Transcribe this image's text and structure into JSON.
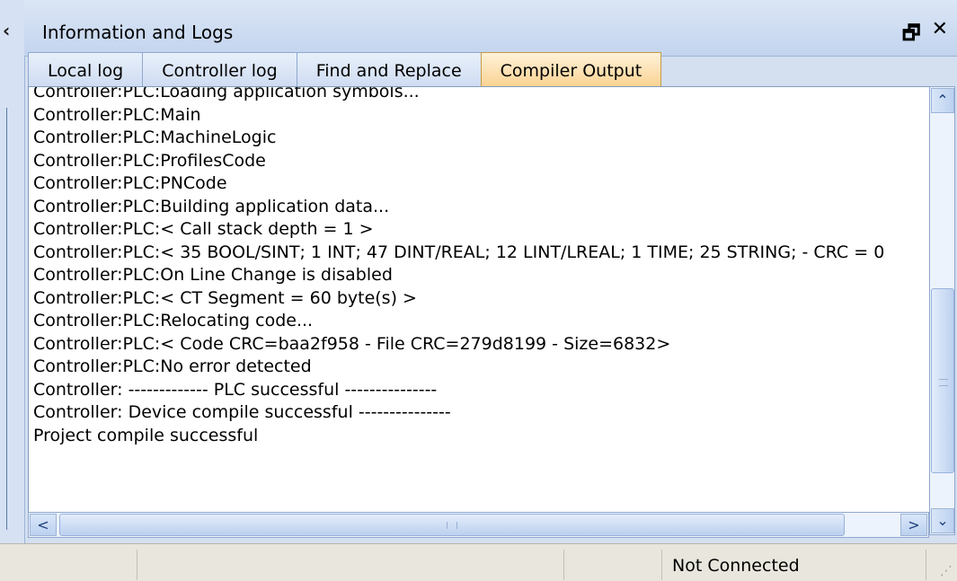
{
  "panel": {
    "title": "Information and Logs",
    "float_icon": "🗗",
    "close_icon": "✕",
    "collapse_icon": "‹"
  },
  "tabs": [
    {
      "label": "Local log",
      "active": false
    },
    {
      "label": "Controller log",
      "active": false
    },
    {
      "label": "Find and Replace",
      "active": false
    },
    {
      "label": "Compiler Output",
      "active": true
    }
  ],
  "log_lines": [
    "Controller:PLC:Loading application symbols...",
    "Controller:PLC:Main",
    "Controller:PLC:MachineLogic",
    "Controller:PLC:ProfilesCode",
    "Controller:PLC:PNCode",
    "Controller:PLC:Building application data...",
    "Controller:PLC:< Call stack depth = 1 >",
    "Controller:PLC:< 35 BOOL/SINT; 1 INT; 47 DINT/REAL; 12 LINT/LREAL; 1 TIME; 25 STRING;  - CRC = 0",
    "Controller:PLC:On Line Change is disabled",
    "Controller:PLC:< CT Segment = 60 byte(s) >",
    "Controller:PLC:Relocating code...",
    "Controller:PLC:< Code CRC=baa2f958 - File CRC=279d8199 - Size=6832>",
    "Controller:PLC:No error detected",
    "Controller: ------------- PLC successful ---------------",
    "Controller:  Device compile  successful ---------------",
    "Project compile successful"
  ],
  "scrollbar": {
    "up_arrow": "⌃",
    "down_arrow": "⌄",
    "left_arrow": "<",
    "right_arrow": ">"
  },
  "status_bar": {
    "connection": "Not Connected",
    "resize_grip": "⋰"
  },
  "colors": {
    "active_tab": "#fad393",
    "panel_bg": "#d4dff0",
    "status_bg": "#e8e6dd"
  }
}
